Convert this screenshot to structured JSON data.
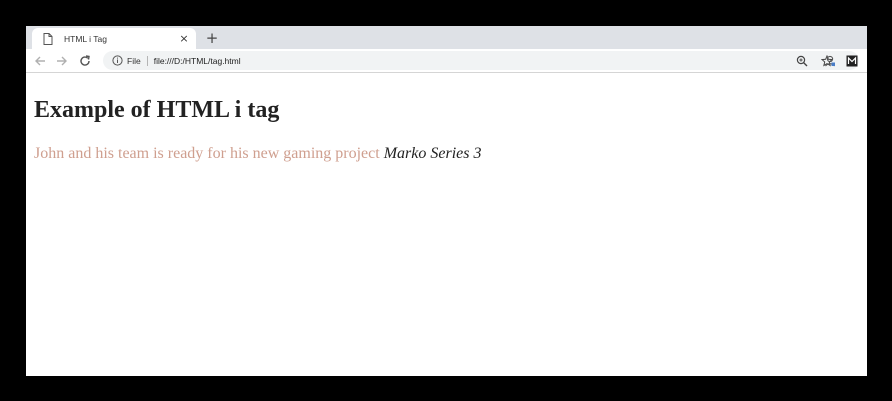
{
  "browser": {
    "tab": {
      "title": "HTML i Tag",
      "favicon": "document-icon",
      "close_label": "×"
    },
    "new_tab_label": "+",
    "toolbar": {
      "back": "back-arrow-icon",
      "forward": "forward-arrow-icon",
      "reload": "reload-icon",
      "omnibox": {
        "info_icon": "info-icon",
        "scheme_label": "File",
        "url": "file:///D:/HTML/tag.html"
      },
      "zoom": "zoom-icon",
      "bookmark": "star-icon",
      "profile": "account-icon",
      "extension": "extension-icon"
    }
  },
  "page": {
    "heading": "Example of HTML i tag",
    "paragraph": {
      "text": "John and his team is ready for his new gaming project ",
      "italic": "Marko Series 3"
    }
  },
  "colors": {
    "tabstrip": "#dee1e6",
    "paragraph_text": "#cf9f8f",
    "heading_text": "#222222"
  }
}
